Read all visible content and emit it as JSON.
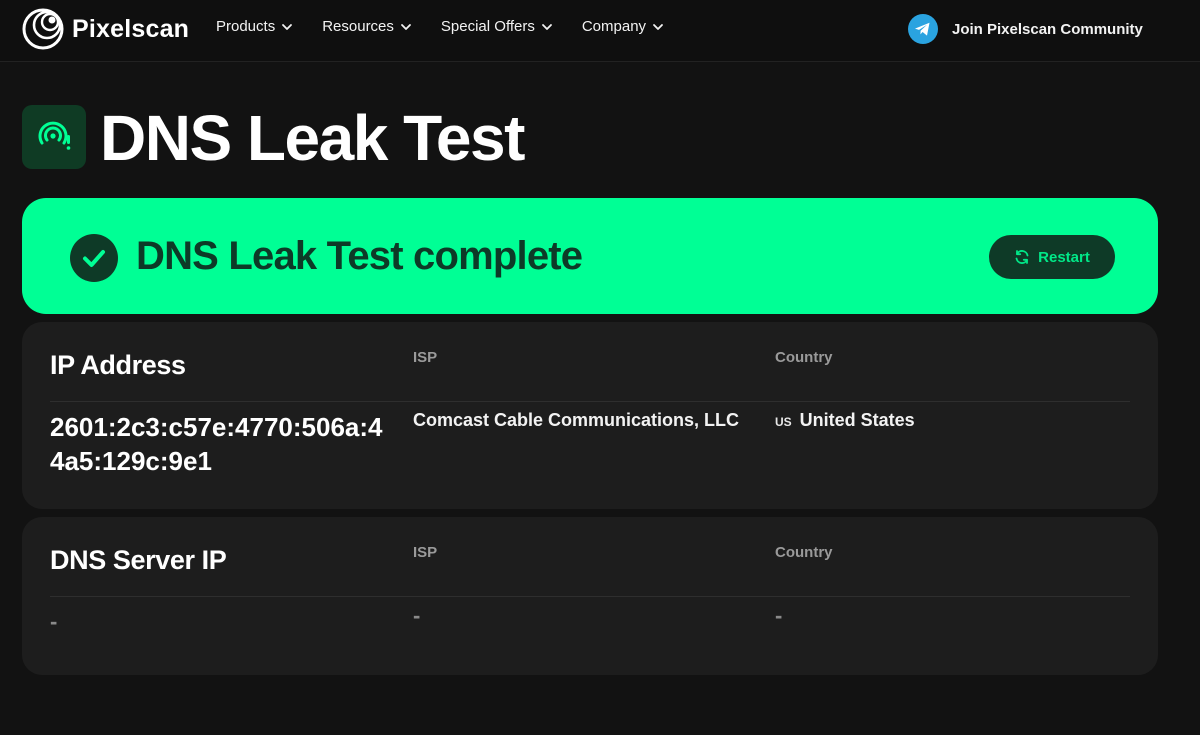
{
  "brand": {
    "name": "Pixelscan",
    "accent": "#00ff95",
    "dark_green": "#0d3a27"
  },
  "nav": {
    "items": [
      {
        "label": "Products",
        "icon": "chevron-down-icon"
      },
      {
        "label": "Resources",
        "icon": "chevron-down-icon"
      },
      {
        "label": "Special Offers",
        "icon": "chevron-down-icon"
      },
      {
        "label": "Company",
        "icon": "chevron-down-icon"
      }
    ],
    "community": {
      "label": "Join Pixelscan Community",
      "icon": "telegram-icon"
    }
  },
  "page": {
    "title": "DNS Leak Test",
    "title_icon": "signal-alert-icon"
  },
  "banner": {
    "status": "DNS Leak Test complete",
    "status_icon": "check-circle-icon",
    "restart_label": "Restart",
    "restart_icon": "refresh-icon"
  },
  "ip_card": {
    "headers": {
      "address": "IP Address",
      "isp": "ISP",
      "country": "Country"
    },
    "row": {
      "address": "2601:2c3:c57e:4770:506a:44a5:129c:9e1",
      "isp": "Comcast Cable Communications, LLC",
      "country_code": "US",
      "country": "United States"
    }
  },
  "dns_card": {
    "headers": {
      "address": "DNS Server IP",
      "isp": "ISP",
      "country": "Country"
    },
    "row": {
      "address": "-",
      "isp": "-",
      "country": "-"
    }
  }
}
